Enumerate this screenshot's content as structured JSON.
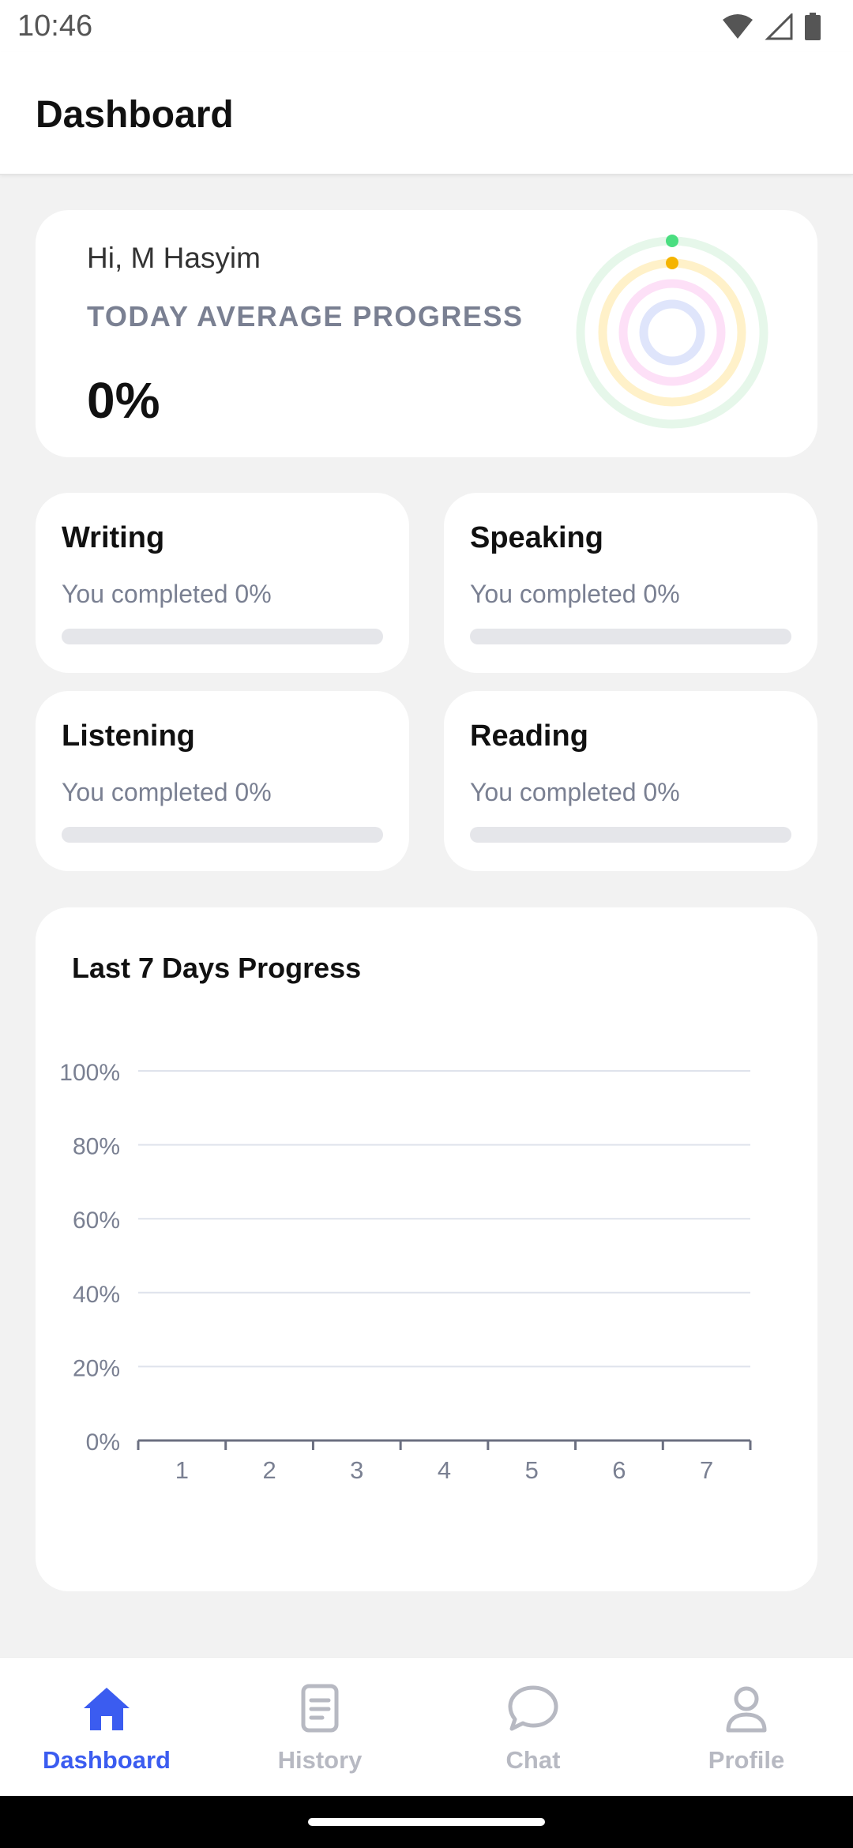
{
  "status_bar": {
    "time": "10:46",
    "icons": [
      "wifi-icon",
      "signal-icon",
      "battery-icon"
    ]
  },
  "header": {
    "title": "Dashboard"
  },
  "summary": {
    "greeting": "Hi, M Hasyim",
    "label": "TODAY AVERAGE PROGRESS",
    "value": "0%",
    "rings": [
      {
        "name": "writing",
        "color": "#4ade80",
        "track": "#e6f7ea",
        "progress": 0
      },
      {
        "name": "speaking",
        "color": "#f5b400",
        "track": "#fff1c9",
        "progress": 0
      },
      {
        "name": "listening",
        "color": "#f0a3e6",
        "track": "#fde0f7",
        "progress": 0
      },
      {
        "name": "reading",
        "color": "#8fa3f5",
        "track": "#dfe5fb",
        "progress": 0
      }
    ]
  },
  "skills": [
    {
      "title": "Writing",
      "subtitle": "You completed 0%",
      "progress": 0
    },
    {
      "title": "Speaking",
      "subtitle": "You completed 0%",
      "progress": 0
    },
    {
      "title": "Listening",
      "subtitle": "You completed 0%",
      "progress": 0
    },
    {
      "title": "Reading",
      "subtitle": "You completed 0%",
      "progress": 0
    }
  ],
  "chart": {
    "title": "Last 7 Days Progress"
  },
  "chart_data": {
    "type": "line",
    "title": "Last 7 Days Progress",
    "xlabel": "",
    "ylabel": "",
    "x": [
      "1",
      "2",
      "3",
      "4",
      "5",
      "6",
      "7"
    ],
    "y_ticks": [
      "0%",
      "20%",
      "40%",
      "60%",
      "80%",
      "100%"
    ],
    "ylim": [
      0,
      100
    ],
    "grid": true,
    "series": []
  },
  "nav": {
    "items": [
      {
        "label": "Dashboard",
        "icon": "home-icon",
        "active": true
      },
      {
        "label": "History",
        "icon": "document-icon",
        "active": false
      },
      {
        "label": "Chat",
        "icon": "chat-bubble-icon",
        "active": false
      },
      {
        "label": "Profile",
        "icon": "person-icon",
        "active": false
      }
    ]
  },
  "colors": {
    "accent": "#3b5cf0",
    "inactive": "#b7b9c2",
    "background": "#f2f2f2",
    "card": "#ffffff",
    "muted_text": "#7a8092",
    "grid_line": "#dfe3ec",
    "axis_line": "#6b6f80"
  }
}
